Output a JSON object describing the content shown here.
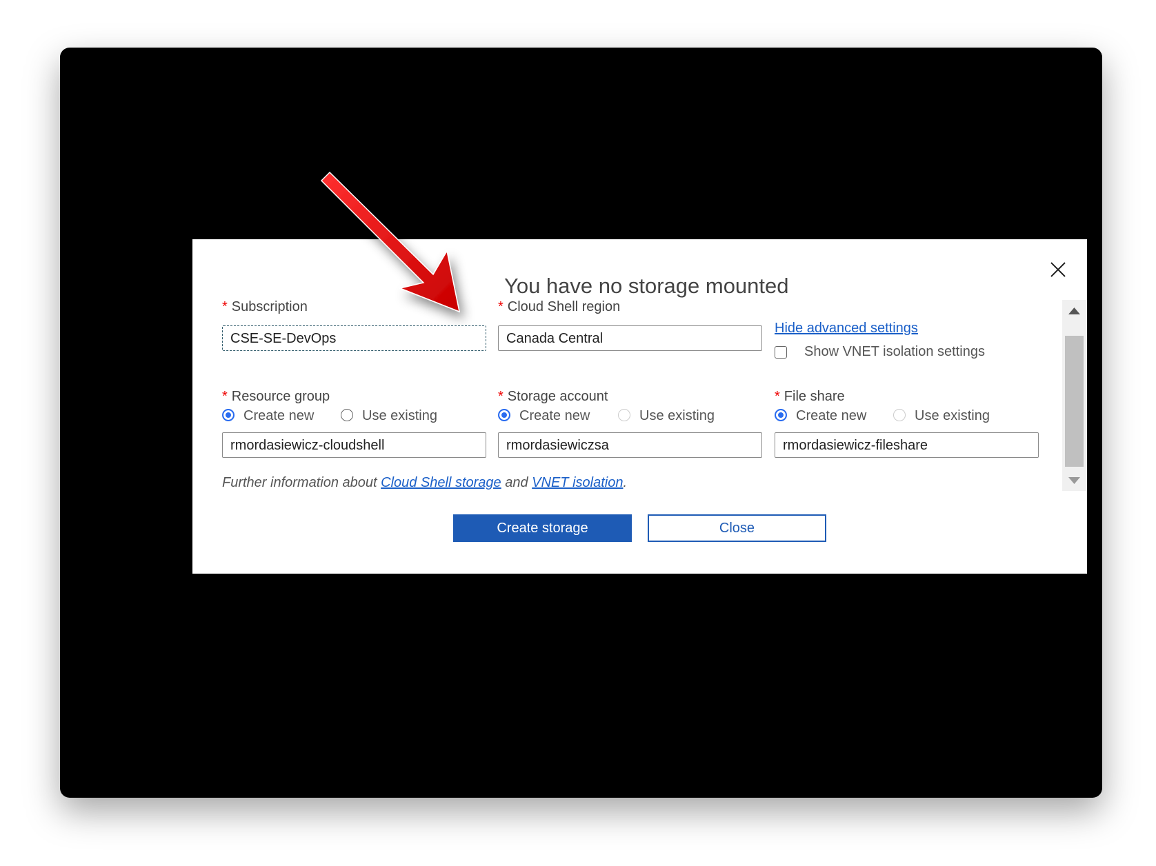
{
  "dialog": {
    "title": "You have no storage mounted",
    "close_icon": "close-icon",
    "required_marker": "*",
    "subscription": {
      "label": "Subscription",
      "value": "CSE-SE-DevOps"
    },
    "region": {
      "label": "Cloud Shell region",
      "value": "Canada Central"
    },
    "advanced_link": "Hide advanced settings",
    "vnet_checkbox": {
      "label": "Show VNET isolation settings",
      "checked": false
    },
    "resource_group": {
      "label": "Resource group",
      "create_new": "Create new",
      "use_existing": "Use existing",
      "value": "rmordasiewicz-cloudshell"
    },
    "storage_account": {
      "label": "Storage account",
      "create_new": "Create new",
      "use_existing": "Use existing",
      "value": "rmordasiewiczsa"
    },
    "file_share": {
      "label": "File share",
      "create_new": "Create new",
      "use_existing": "Use existing",
      "value": "rmordasiewicz-fileshare"
    },
    "info": {
      "prefix": "Further information about ",
      "link1": "Cloud Shell storage",
      "middle": " and ",
      "link2": "VNET isolation",
      "suffix": "."
    },
    "create_button": "Create storage",
    "close_button": "Close"
  },
  "colors": {
    "primary": "#1e5bb5",
    "required": "#e00000",
    "annotation_arrow": "#e00000"
  }
}
